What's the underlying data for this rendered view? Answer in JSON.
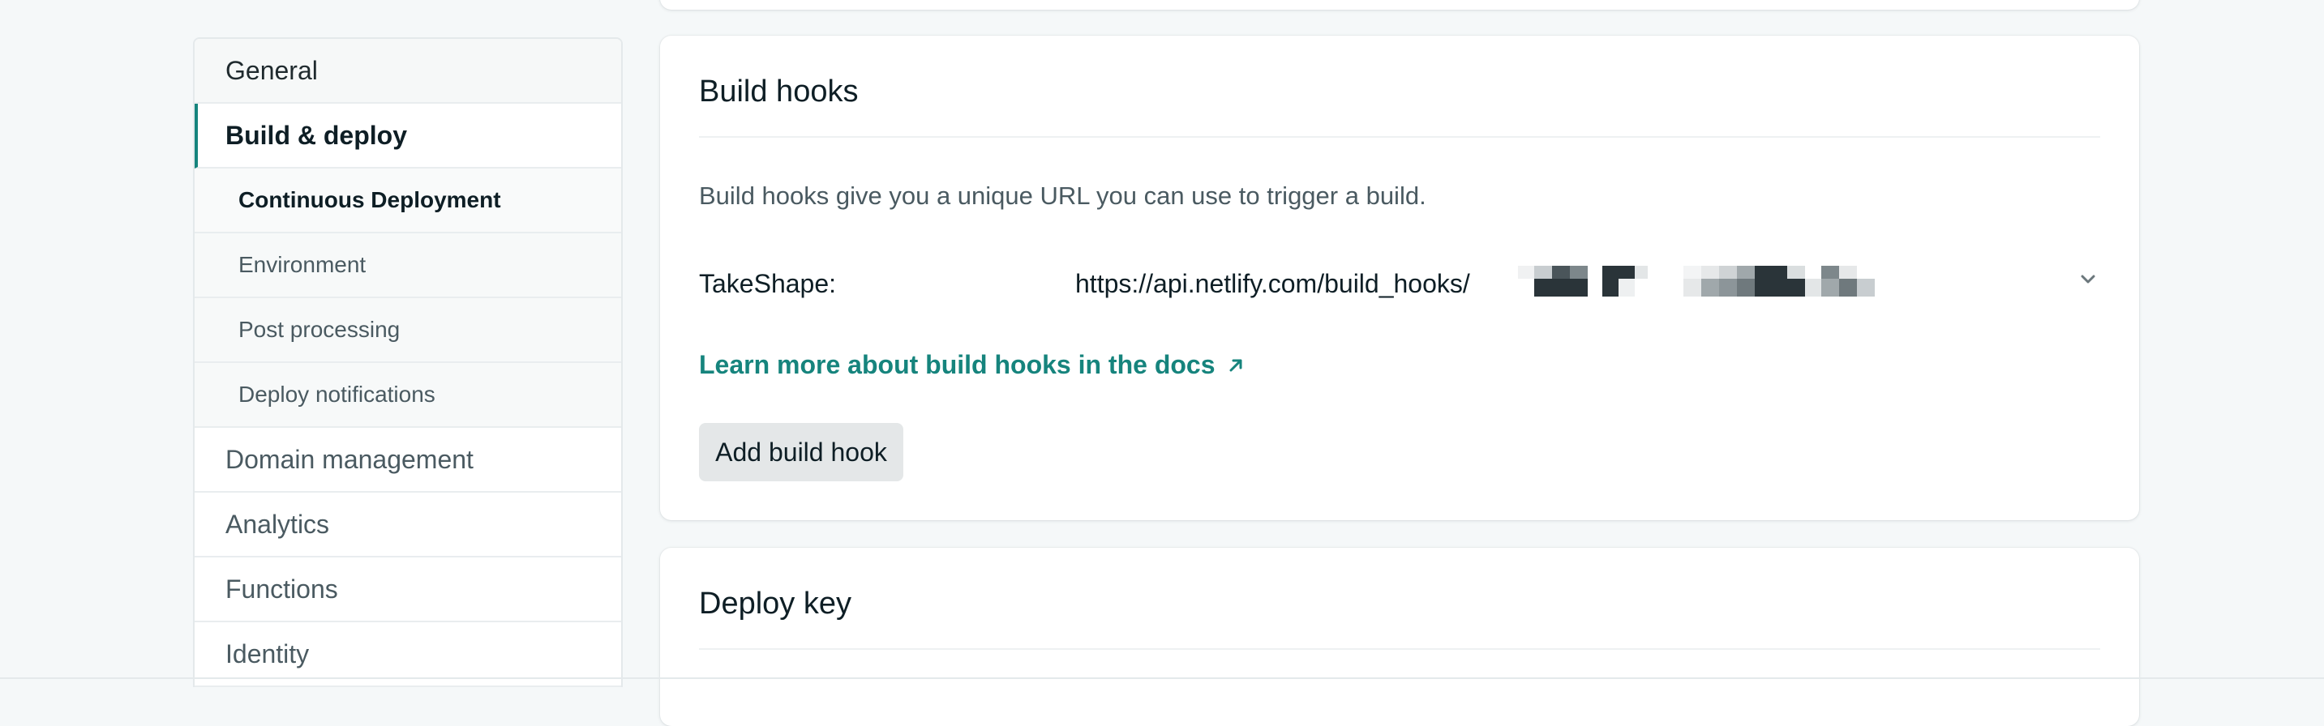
{
  "sidebar": {
    "items": [
      {
        "label": "General"
      },
      {
        "label": "Build & deploy"
      },
      {
        "label": "Continuous Deployment"
      },
      {
        "label": "Environment"
      },
      {
        "label": "Post processing"
      },
      {
        "label": "Deploy notifications"
      },
      {
        "label": "Domain management"
      },
      {
        "label": "Analytics"
      },
      {
        "label": "Functions"
      },
      {
        "label": "Identity"
      }
    ]
  },
  "build_hooks": {
    "title": "Build hooks",
    "description": "Build hooks give you a unique URL you can use to trigger a build.",
    "hook": {
      "name": "TakeShape:",
      "url_prefix": "https://api.netlify.com/build_hooks/"
    },
    "learn_more": "Learn more about build hooks in the docs",
    "learn_more_icon": "external-arrow-icon",
    "add_button": "Add build hook",
    "expand_icon": "chevron-down-icon"
  },
  "deploy_key": {
    "title": "Deploy key"
  },
  "colors": {
    "accent": "#15847d",
    "background": "#f5f8f9",
    "card": "#ffffff",
    "button": "#e4e7e8"
  }
}
